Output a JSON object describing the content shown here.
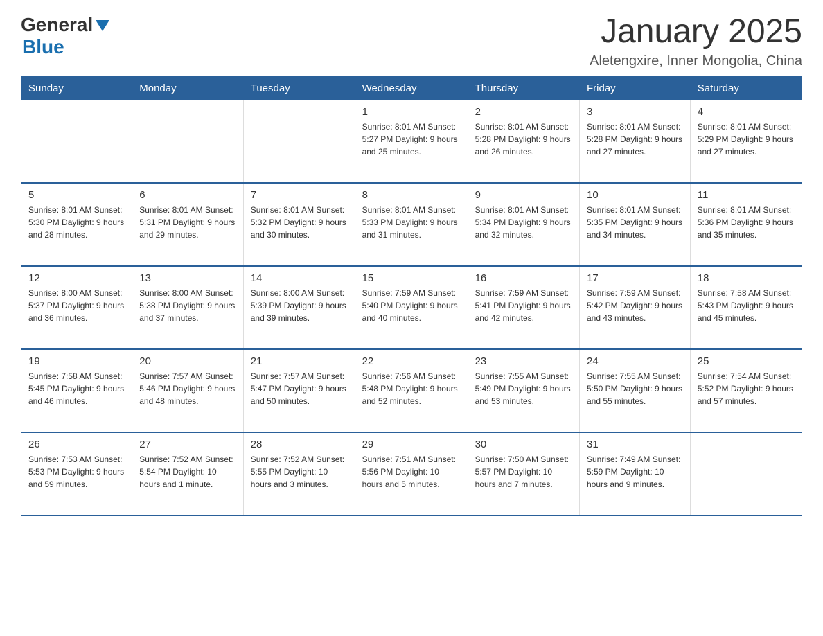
{
  "logo": {
    "general": "General",
    "blue": "Blue"
  },
  "header": {
    "month_title": "January 2025",
    "location": "Aletengxire, Inner Mongolia, China"
  },
  "days_of_week": [
    "Sunday",
    "Monday",
    "Tuesday",
    "Wednesday",
    "Thursday",
    "Friday",
    "Saturday"
  ],
  "weeks": [
    [
      {
        "day": "",
        "info": ""
      },
      {
        "day": "",
        "info": ""
      },
      {
        "day": "",
        "info": ""
      },
      {
        "day": "1",
        "info": "Sunrise: 8:01 AM\nSunset: 5:27 PM\nDaylight: 9 hours and 25 minutes."
      },
      {
        "day": "2",
        "info": "Sunrise: 8:01 AM\nSunset: 5:28 PM\nDaylight: 9 hours and 26 minutes."
      },
      {
        "day": "3",
        "info": "Sunrise: 8:01 AM\nSunset: 5:28 PM\nDaylight: 9 hours and 27 minutes."
      },
      {
        "day": "4",
        "info": "Sunrise: 8:01 AM\nSunset: 5:29 PM\nDaylight: 9 hours and 27 minutes."
      }
    ],
    [
      {
        "day": "5",
        "info": "Sunrise: 8:01 AM\nSunset: 5:30 PM\nDaylight: 9 hours and 28 minutes."
      },
      {
        "day": "6",
        "info": "Sunrise: 8:01 AM\nSunset: 5:31 PM\nDaylight: 9 hours and 29 minutes."
      },
      {
        "day": "7",
        "info": "Sunrise: 8:01 AM\nSunset: 5:32 PM\nDaylight: 9 hours and 30 minutes."
      },
      {
        "day": "8",
        "info": "Sunrise: 8:01 AM\nSunset: 5:33 PM\nDaylight: 9 hours and 31 minutes."
      },
      {
        "day": "9",
        "info": "Sunrise: 8:01 AM\nSunset: 5:34 PM\nDaylight: 9 hours and 32 minutes."
      },
      {
        "day": "10",
        "info": "Sunrise: 8:01 AM\nSunset: 5:35 PM\nDaylight: 9 hours and 34 minutes."
      },
      {
        "day": "11",
        "info": "Sunrise: 8:01 AM\nSunset: 5:36 PM\nDaylight: 9 hours and 35 minutes."
      }
    ],
    [
      {
        "day": "12",
        "info": "Sunrise: 8:00 AM\nSunset: 5:37 PM\nDaylight: 9 hours and 36 minutes."
      },
      {
        "day": "13",
        "info": "Sunrise: 8:00 AM\nSunset: 5:38 PM\nDaylight: 9 hours and 37 minutes."
      },
      {
        "day": "14",
        "info": "Sunrise: 8:00 AM\nSunset: 5:39 PM\nDaylight: 9 hours and 39 minutes."
      },
      {
        "day": "15",
        "info": "Sunrise: 7:59 AM\nSunset: 5:40 PM\nDaylight: 9 hours and 40 minutes."
      },
      {
        "day": "16",
        "info": "Sunrise: 7:59 AM\nSunset: 5:41 PM\nDaylight: 9 hours and 42 minutes."
      },
      {
        "day": "17",
        "info": "Sunrise: 7:59 AM\nSunset: 5:42 PM\nDaylight: 9 hours and 43 minutes."
      },
      {
        "day": "18",
        "info": "Sunrise: 7:58 AM\nSunset: 5:43 PM\nDaylight: 9 hours and 45 minutes."
      }
    ],
    [
      {
        "day": "19",
        "info": "Sunrise: 7:58 AM\nSunset: 5:45 PM\nDaylight: 9 hours and 46 minutes."
      },
      {
        "day": "20",
        "info": "Sunrise: 7:57 AM\nSunset: 5:46 PM\nDaylight: 9 hours and 48 minutes."
      },
      {
        "day": "21",
        "info": "Sunrise: 7:57 AM\nSunset: 5:47 PM\nDaylight: 9 hours and 50 minutes."
      },
      {
        "day": "22",
        "info": "Sunrise: 7:56 AM\nSunset: 5:48 PM\nDaylight: 9 hours and 52 minutes."
      },
      {
        "day": "23",
        "info": "Sunrise: 7:55 AM\nSunset: 5:49 PM\nDaylight: 9 hours and 53 minutes."
      },
      {
        "day": "24",
        "info": "Sunrise: 7:55 AM\nSunset: 5:50 PM\nDaylight: 9 hours and 55 minutes."
      },
      {
        "day": "25",
        "info": "Sunrise: 7:54 AM\nSunset: 5:52 PM\nDaylight: 9 hours and 57 minutes."
      }
    ],
    [
      {
        "day": "26",
        "info": "Sunrise: 7:53 AM\nSunset: 5:53 PM\nDaylight: 9 hours and 59 minutes."
      },
      {
        "day": "27",
        "info": "Sunrise: 7:52 AM\nSunset: 5:54 PM\nDaylight: 10 hours and 1 minute."
      },
      {
        "day": "28",
        "info": "Sunrise: 7:52 AM\nSunset: 5:55 PM\nDaylight: 10 hours and 3 minutes."
      },
      {
        "day": "29",
        "info": "Sunrise: 7:51 AM\nSunset: 5:56 PM\nDaylight: 10 hours and 5 minutes."
      },
      {
        "day": "30",
        "info": "Sunrise: 7:50 AM\nSunset: 5:57 PM\nDaylight: 10 hours and 7 minutes."
      },
      {
        "day": "31",
        "info": "Sunrise: 7:49 AM\nSunset: 5:59 PM\nDaylight: 10 hours and 9 minutes."
      },
      {
        "day": "",
        "info": ""
      }
    ]
  ]
}
